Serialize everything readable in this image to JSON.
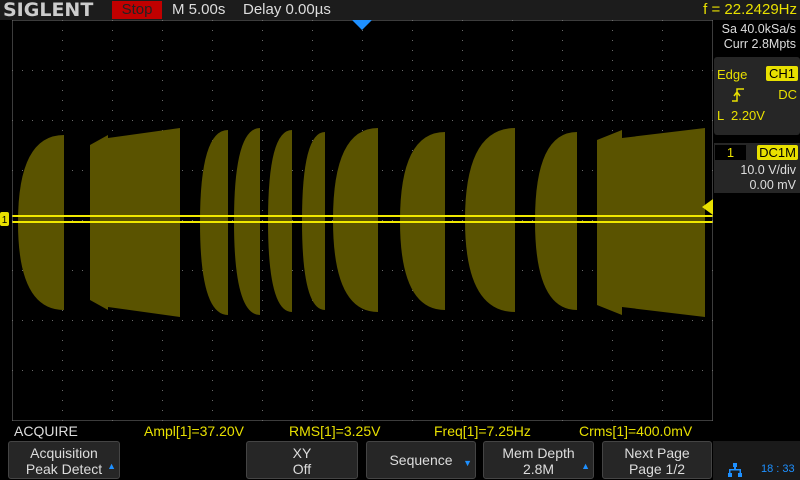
{
  "header": {
    "logo": "SIGLENT",
    "run_state": "Stop",
    "timebase": "M 5.00s",
    "delay": "Delay 0.00µs",
    "frequency": "f = 22.2429Hz"
  },
  "acq_info": {
    "sample_rate": "Sa 40.0kSa/s",
    "memory": "Curr 2.8Mpts"
  },
  "trigger": {
    "type": "Edge",
    "source": "CH1",
    "slope_icon": "rising-edge-icon",
    "coupling": "DC",
    "level": "L  2.20V"
  },
  "channel": {
    "number": "1",
    "coupling": "DC1M",
    "scale": "10.0 V/div",
    "offset": "0.00 mV"
  },
  "measurements": {
    "menu": "ACQUIRE",
    "items": [
      "Ampl[1]=37.20V",
      "RMS[1]=3.25V",
      "Freq[1]=7.25Hz",
      "Crms[1]=400.0mV"
    ]
  },
  "softkeys": [
    {
      "line1": "Acquisition",
      "line2": "Peak  Detect",
      "arrow": "up"
    },
    {
      "line1": "XY",
      "line2": "Off"
    },
    {
      "line1": "Sequence",
      "line2": "",
      "arrow": "down"
    },
    {
      "line1": "Mem Depth",
      "line2": "2.8M",
      "arrow": "up"
    },
    {
      "line1": "Next Page",
      "line2": "Page 1/2"
    }
  ],
  "status": {
    "time": "18 : 33",
    "network_icon": "network-icon"
  },
  "colors": {
    "ch1": "#e8e000",
    "trace_fill": "#5a5300",
    "stop": "#c00000",
    "accent": "#1e90ff"
  }
}
